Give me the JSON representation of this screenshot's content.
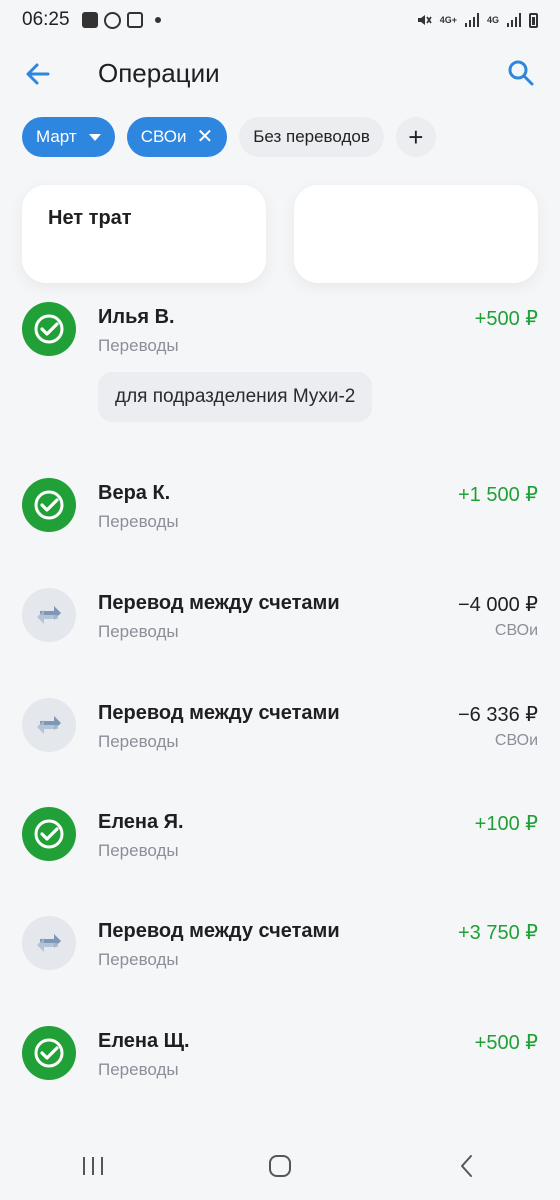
{
  "status_bar": {
    "time": "06:25",
    "net1": "4G+",
    "net2": "4G"
  },
  "header": {
    "title": "Операции",
    "back_icon": "arrow-left-icon",
    "search_icon": "search-icon"
  },
  "filters": {
    "month": "Март",
    "account": "СВОи",
    "no_transfers": "Без переводов",
    "add": "+"
  },
  "summary_cards": {
    "left_title": "Нет трат",
    "right_title": ""
  },
  "transactions": [
    {
      "name": "Илья В.",
      "category": "Переводы",
      "amount": "+500 ₽",
      "account": "",
      "note": "для подразделения Мухи-2",
      "icon": "sber-check-icon"
    },
    {
      "name": "Вера К.",
      "category": "Переводы",
      "amount": "+1 500 ₽",
      "account": "",
      "icon": "sber-check-icon"
    },
    {
      "name": "Перевод между счетами",
      "category": "Переводы",
      "amount": "−4 000 ₽",
      "account": "СВОи",
      "icon": "transfer-arrows-icon"
    },
    {
      "name": "Перевод между счетами",
      "category": "Переводы",
      "amount": "−6 336 ₽",
      "account": "СВОи",
      "icon": "transfer-arrows-icon"
    },
    {
      "name": "Елена Я.",
      "category": "Переводы",
      "amount": "+100 ₽",
      "account": "",
      "icon": "sber-check-icon"
    },
    {
      "name": "Перевод между счетами",
      "category": "Переводы",
      "amount": "+3 750 ₽",
      "account": "",
      "icon": "transfer-arrows-icon"
    },
    {
      "name": "Елена Щ.",
      "category": "Переводы",
      "amount": "+500 ₽",
      "account": "",
      "icon": "sber-check-icon"
    }
  ],
  "colors": {
    "accent": "#2e86de",
    "positive": "#21a038",
    "secondary_text": "#8a8f98"
  },
  "nav": {
    "recents_icon": "recents-icon",
    "home_icon": "home-icon",
    "back_icon": "back-chevron-icon"
  }
}
